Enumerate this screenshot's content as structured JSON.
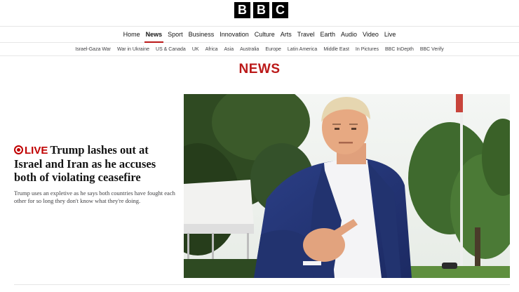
{
  "logo": {
    "letters": [
      "B",
      "B",
      "C"
    ]
  },
  "primary_nav": [
    {
      "label": "Home",
      "active": false
    },
    {
      "label": "News",
      "active": true
    },
    {
      "label": "Sport",
      "active": false
    },
    {
      "label": "Business",
      "active": false
    },
    {
      "label": "Innovation",
      "active": false
    },
    {
      "label": "Culture",
      "active": false
    },
    {
      "label": "Arts",
      "active": false
    },
    {
      "label": "Travel",
      "active": false
    },
    {
      "label": "Earth",
      "active": false
    },
    {
      "label": "Audio",
      "active": false
    },
    {
      "label": "Video",
      "active": false
    },
    {
      "label": "Live",
      "active": false
    }
  ],
  "secondary_nav": [
    "Israel-Gaza War",
    "War in Ukraine",
    "US & Canada",
    "UK",
    "Africa",
    "Asia",
    "Australia",
    "Europe",
    "Latin America",
    "Middle East",
    "In Pictures",
    "BBC InDepth",
    "BBC Verify"
  ],
  "section": {
    "title": "NEWS"
  },
  "lead_story": {
    "live_label": "LIVE",
    "headline": "Trump lashes out at Israel and Iran as he accuses both of violating ceasefire",
    "summary": "Trump uses an expletive as he says both countries have fought each other for so long they don't know what they're doing."
  },
  "colors": {
    "accent": "#bb1919",
    "live": "#c00000"
  }
}
